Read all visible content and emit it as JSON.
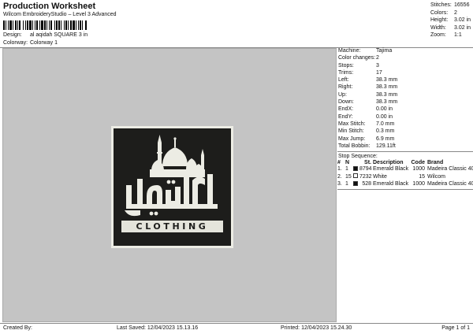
{
  "header": {
    "title": "Production Worksheet",
    "subtitle": "Wilcom EmbroideryStudio – Level 3 Advanced",
    "design_label": "Design:",
    "design_value": "al aqidah SQUARE 3 in",
    "colorway_label": "Colorway:",
    "colorway_value": "Colorway 1"
  },
  "stats": [
    {
      "label": "Stitches:",
      "value": "16556"
    },
    {
      "label": "Colors:",
      "value": "2"
    },
    {
      "label": "Height:",
      "value": "3.02 in"
    },
    {
      "label": "Width:",
      "value": "3.02 in"
    },
    {
      "label": "Zoom:",
      "value": "1:1"
    }
  ],
  "properties": [
    {
      "label": "Machine:",
      "value": "Tajima"
    },
    {
      "label": "Color changes:",
      "value": "2"
    },
    {
      "label": "Stops:",
      "value": "3"
    },
    {
      "label": "Trims:",
      "value": "17"
    },
    {
      "label": "Left:",
      "value": "38.3 mm"
    },
    {
      "label": "Right:",
      "value": "38.3 mm"
    },
    {
      "label": "Up:",
      "value": "38.3 mm"
    },
    {
      "label": "Down:",
      "value": "38.3 mm"
    },
    {
      "label": "EndX:",
      "value": "0.00 in"
    },
    {
      "label": "EndY:",
      "value": "0.00 in"
    },
    {
      "label": "Max Stitch:",
      "value": "7.0 mm"
    },
    {
      "label": "Min Stitch:",
      "value": "0.3 mm"
    },
    {
      "label": "Max Jump:",
      "value": "6.9 mm"
    },
    {
      "label": "Total Bobbin:",
      "value": "129.11ft"
    }
  ],
  "stop_sequence": {
    "title": "Stop Sequence:",
    "headers": [
      "#",
      "N",
      "St.",
      "Description",
      "Code",
      "Brand"
    ],
    "rows": [
      {
        "num": "1.",
        "n": "1",
        "color": "#111111",
        "st": "8794",
        "desc": "Emerald Black",
        "code": "1000",
        "brand": "Madeira Classic 40"
      },
      {
        "num": "2.",
        "n": "15",
        "color": "#ffffff",
        "st": "7232",
        "desc": "White",
        "code": "15",
        "brand": "Wilcom"
      },
      {
        "num": "3.",
        "n": "1",
        "color": "#111111",
        "st": "528",
        "desc": "Emerald Black",
        "code": "1000",
        "brand": "Madeira Classic 40"
      }
    ]
  },
  "design": {
    "patch_text": "CLOTHING",
    "patch_background": "#1d1d1b",
    "stitch_color": "#ecece4"
  },
  "footer": {
    "created_by": "Created By:",
    "last_saved": "Last Saved: 12/04/2023 15.13.16",
    "printed": "Printed: 12/04/2023 15.24.30",
    "page": "Page 1 of 1"
  }
}
